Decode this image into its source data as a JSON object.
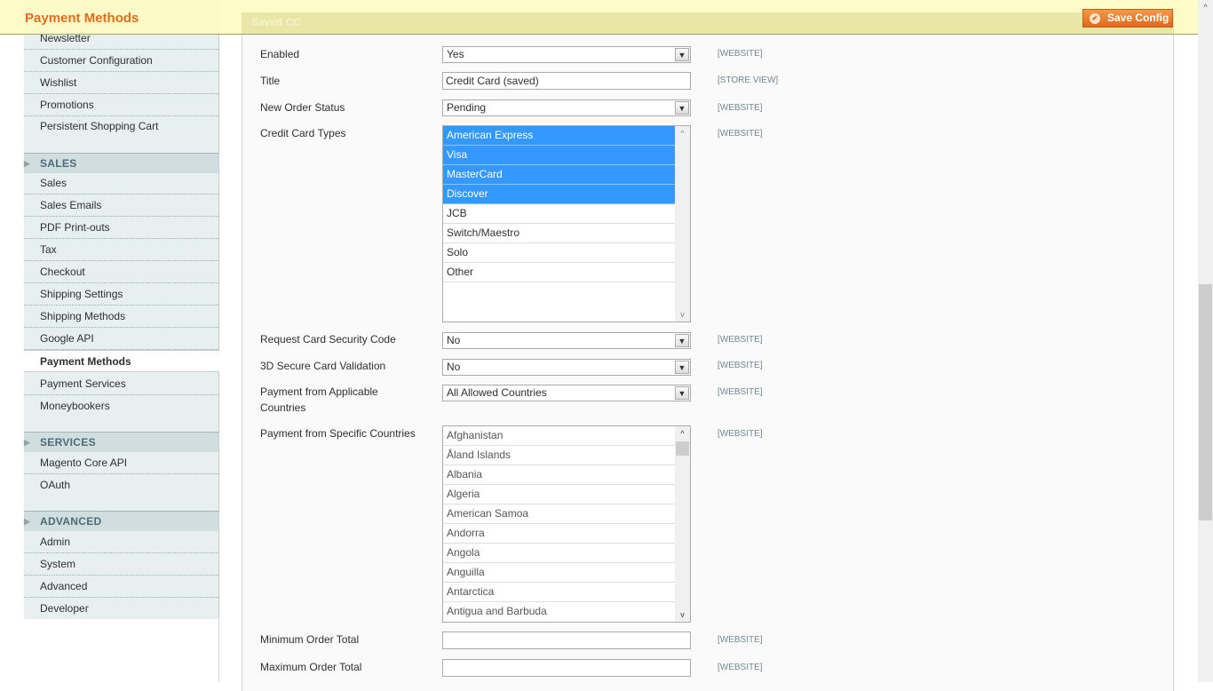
{
  "header": {
    "title": "Payment Methods",
    "section_title": "Saved CC",
    "save_label": "Save Config"
  },
  "sidebar": {
    "customers_items": [
      "Newsletter",
      "Customer Configuration",
      "Wishlist",
      "Promotions",
      "Persistent Shopping Cart"
    ],
    "sales": {
      "title": "SALES",
      "items": [
        "Sales",
        "Sales Emails",
        "PDF Print-outs",
        "Tax",
        "Checkout",
        "Shipping Settings",
        "Shipping Methods",
        "Google API",
        "Payment Methods",
        "Payment Services",
        "Moneybookers"
      ],
      "active": "Payment Methods"
    },
    "services": {
      "title": "SERVICES",
      "items": [
        "Magento Core API",
        "OAuth"
      ]
    },
    "advanced": {
      "title": "ADVANCED",
      "items": [
        "Admin",
        "System",
        "Advanced",
        "Developer"
      ]
    }
  },
  "form": {
    "enabled": {
      "label": "Enabled",
      "value": "Yes",
      "scope": "[WEBSITE]"
    },
    "title": {
      "label": "Title",
      "value": "Credit Card (saved)",
      "scope": "[STORE VIEW]"
    },
    "order_status": {
      "label": "New Order Status",
      "value": "Pending",
      "scope": "[WEBSITE]"
    },
    "cc_types": {
      "label": "Credit Card Types",
      "scope": "[WEBSITE]",
      "options": [
        "American Express",
        "Visa",
        "MasterCard",
        "Discover",
        "JCB",
        "Switch/Maestro",
        "Solo",
        "Other"
      ],
      "selected": [
        "American Express",
        "Visa",
        "MasterCard",
        "Discover"
      ]
    },
    "security_code": {
      "label": "Request Card Security Code",
      "value": "No",
      "scope": "[WEBSITE]"
    },
    "secure3d": {
      "label": "3D Secure Card Validation",
      "value": "No",
      "scope": "[WEBSITE]"
    },
    "applicable_countries": {
      "label": "Payment from Applicable Countries",
      "value": "All Allowed Countries",
      "scope": "[WEBSITE]"
    },
    "specific_countries": {
      "label": "Payment from Specific Countries",
      "scope": "[WEBSITE]",
      "options": [
        "Afghanistan",
        "Åland Islands",
        "Albania",
        "Algeria",
        "American Samoa",
        "Andorra",
        "Angola",
        "Anguilla",
        "Antarctica",
        "Antigua and Barbuda"
      ]
    },
    "min_total": {
      "label": "Minimum Order Total",
      "value": "",
      "scope": "[WEBSITE]"
    },
    "max_total": {
      "label": "Maximum Order Total",
      "value": "",
      "scope": "[WEBSITE]"
    }
  },
  "colors": {
    "accent": "#e26b1e",
    "selection": "#3399ff",
    "sidebar_bg": "#e7efef",
    "header_bg": "#fdfbc4"
  }
}
